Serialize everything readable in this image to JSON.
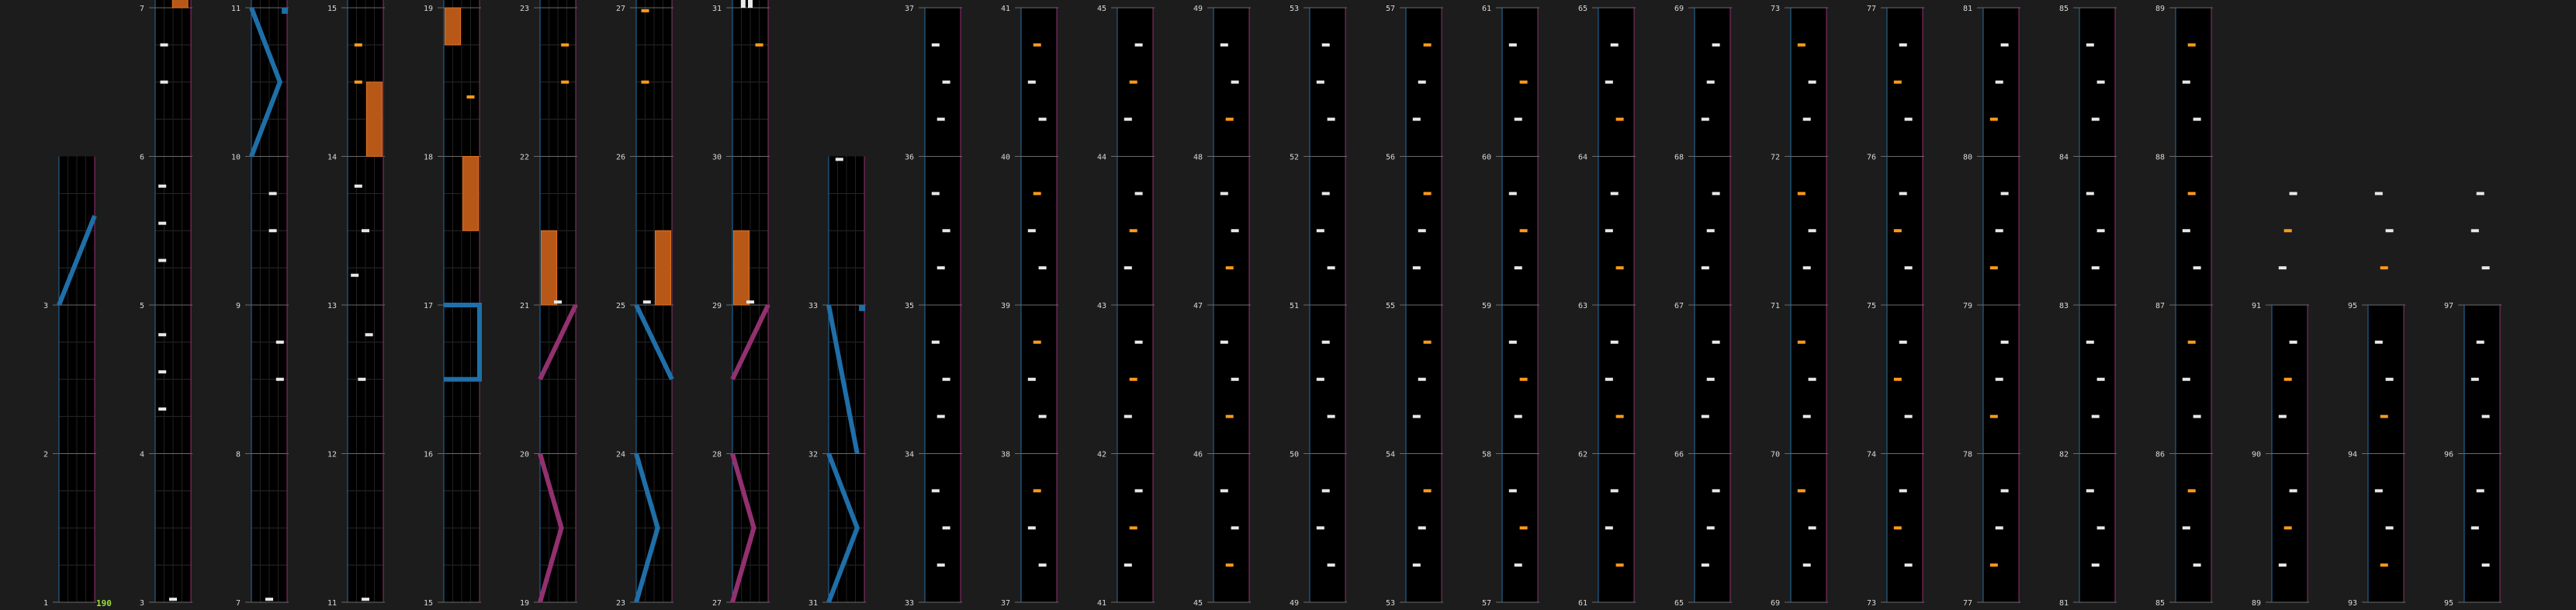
{
  "combo": "190",
  "colors": {
    "background": "#1c1c1c",
    "lane_bg": "#000000",
    "left_lane": "#1f6fa8",
    "right_lane": "#93306f",
    "hold": "#b85818",
    "tap_white": "#e8e8e8",
    "tap_orange": "#ff9a1a",
    "combo_text": "#9be03a"
  },
  "columns": [
    {
      "col": 0,
      "segments": [
        {
          "label": "1",
          "events": []
        },
        {
          "label": "2",
          "events": []
        },
        {
          "label": "3",
          "events": [
            {
              "type": "slide",
              "side": "L",
              "pts": [
                [
                  0,
                  0
                ],
                [
                  1,
                  0.6
                ]
              ]
            }
          ]
        }
      ]
    },
    {
      "col": 1,
      "segments": [
        {
          "label": "3",
          "events": [
            {
              "type": "tap",
              "lane": 0.5,
              "t": 0.02
            }
          ]
        },
        {
          "label": "4",
          "events": [
            {
              "type": "tap",
              "lane": 0.2,
              "t": 0.3
            },
            {
              "type": "tap",
              "lane": 0.2,
              "t": 0.55
            },
            {
              "type": "tap",
              "lane": 0.2,
              "t": 0.8
            }
          ]
        },
        {
          "label": "5",
          "events": [
            {
              "type": "tap",
              "lane": 0.2,
              "t": 0.3
            },
            {
              "type": "tap",
              "lane": 0.2,
              "t": 0.55
            },
            {
              "type": "tap",
              "lane": 0.2,
              "t": 0.8
            }
          ]
        },
        {
          "label": "6",
          "events": [
            {
              "type": "tap",
              "lane": 0.25,
              "t": 0.5
            },
            {
              "type": "tap",
              "lane": 0.25,
              "t": 0.75
            }
          ]
        },
        {
          "label": "7",
          "events": [
            {
              "type": "hold",
              "lane": 0.7,
              "t0": 0,
              "t1": 0.6
            },
            {
              "type": "tap",
              "lane": 0.4,
              "t": 0.98
            }
          ]
        }
      ]
    },
    {
      "col": 2,
      "segments": [
        {
          "label": "7",
          "events": [
            {
              "type": "tap",
              "lane": 0.5,
              "t": 0.02
            }
          ]
        },
        {
          "label": "8",
          "events": [
            {
              "type": "tap",
              "lane": 0.8,
              "t": 0.5
            },
            {
              "type": "tap",
              "lane": 0.8,
              "t": 0.75
            }
          ]
        },
        {
          "label": "9",
          "events": [
            {
              "type": "tap",
              "lane": 0.6,
              "t": 0.5
            },
            {
              "type": "tap",
              "lane": 0.6,
              "t": 0.75
            }
          ]
        },
        {
          "label": "10",
          "events": [
            {
              "type": "slide",
              "side": "L",
              "pts": [
                [
                  0,
                  0
                ],
                [
                  0.8,
                  0.5
                ],
                [
                  0,
                  1
                ]
              ]
            },
            {
              "type": "wall",
              "side": "L",
              "t": 0.98
            }
          ]
        },
        {
          "label": "11",
          "events": [
            {
              "type": "tap",
              "lane": 0.9,
              "t": 0.98
            }
          ]
        }
      ]
    },
    {
      "col": 3,
      "segments": [
        {
          "label": "11",
          "events": [
            {
              "type": "tap",
              "lane": 0.5,
              "t": 0.02
            }
          ]
        },
        {
          "label": "12",
          "events": [
            {
              "type": "tap",
              "lane": 0.4,
              "t": 0.5
            },
            {
              "type": "tap",
              "lane": 0.6,
              "t": 0.8
            }
          ]
        },
        {
          "label": "13",
          "events": [
            {
              "type": "tap",
              "lane": 0.2,
              "t": 0.2
            },
            {
              "type": "tap",
              "lane": 0.5,
              "t": 0.5
            },
            {
              "type": "tap",
              "lane": 0.3,
              "t": 0.8
            }
          ]
        },
        {
          "label": "14",
          "events": [
            {
              "type": "hold",
              "lane": 0.75,
              "t0": 0,
              "t1": 0.5
            },
            {
              "type": "tapo",
              "lane": 0.3,
              "t": 0.5
            },
            {
              "type": "tapo",
              "lane": 0.3,
              "t": 0.75
            }
          ]
        },
        {
          "label": "15",
          "events": [
            {
              "type": "tapo",
              "lane": 0.75,
              "t": 0.25
            },
            {
              "type": "tap",
              "lane": 0.5,
              "t": 0.55
            },
            {
              "type": "tap",
              "lane": 0.5,
              "t": 0.75
            },
            {
              "type": "tap",
              "lane": 0.75,
              "t": 0.98
            }
          ]
        }
      ]
    },
    {
      "col": 4,
      "segments": [
        {
          "label": "15",
          "events": []
        },
        {
          "label": "16",
          "events": [
            {
              "type": "wallpath",
              "side": "L",
              "pts": [
                [
                  0,
                  0.5
                ],
                [
                  1,
                  0.5
                ],
                [
                  1,
                  1
                ],
                [
                  0,
                  1
                ]
              ]
            }
          ]
        },
        {
          "label": "17",
          "events": [
            {
              "type": "hold",
              "lane": 0.75,
              "t0": 0.5,
              "t1": 1
            }
          ]
        },
        {
          "label": "18",
          "events": [
            {
              "type": "tapo",
              "lane": 0.75,
              "t": 0.4
            },
            {
              "type": "hold",
              "lane": 0.25,
              "t0": 0.75,
              "t1": 1
            }
          ]
        },
        {
          "label": "19",
          "events": [
            {
              "type": "wallpath",
              "side": "R",
              "pts": [
                [
                  0,
                  1
                ],
                [
                  0,
                  0.4
                ],
                [
                  1,
                  0.4
                ]
              ]
            }
          ]
        }
      ]
    },
    {
      "col": 5,
      "segments": [
        {
          "label": "19",
          "events": [
            {
              "type": "slide",
              "side": "R",
              "pts": [
                [
                  0,
                  0
                ],
                [
                  0.6,
                  0.5
                ],
                [
                  0,
                  1
                ]
              ]
            }
          ]
        },
        {
          "label": "20",
          "events": [
            {
              "type": "slide",
              "side": "R",
              "pts": [
                [
                  0,
                  0.5
                ],
                [
                  1,
                  1
                ]
              ]
            }
          ]
        },
        {
          "label": "21",
          "events": [
            {
              "type": "hold",
              "lane": 0.25,
              "t0": 0,
              "t1": 0.5
            },
            {
              "type": "tap",
              "lane": 0.5,
              "t": 0.02
            }
          ]
        },
        {
          "label": "22",
          "events": [
            {
              "type": "tapo",
              "lane": 0.7,
              "t": 0.5
            },
            {
              "type": "tapo",
              "lane": 0.7,
              "t": 0.75
            }
          ]
        },
        {
          "label": "23",
          "events": [
            {
              "type": "tap",
              "lane": 0.3,
              "t": 0.25
            },
            {
              "type": "tap",
              "lane": 0.5,
              "t": 0.5
            },
            {
              "type": "tap",
              "lane": 0.6,
              "t": 0.75
            },
            {
              "type": "wall",
              "side": "L",
              "t": 0.98
            }
          ]
        }
      ]
    },
    {
      "col": 6,
      "segments": [
        {
          "label": "23",
          "events": [
            {
              "type": "slide",
              "side": "L",
              "pts": [
                [
                  0,
                  0
                ],
                [
                  0.6,
                  0.5
                ],
                [
                  0,
                  1
                ]
              ]
            }
          ]
        },
        {
          "label": "24",
          "events": [
            {
              "type": "slide",
              "side": "L",
              "pts": [
                [
                  0,
                  1
                ],
                [
                  1,
                  0.5
                ]
              ]
            }
          ]
        },
        {
          "label": "25",
          "events": [
            {
              "type": "hold",
              "lane": 0.75,
              "t0": 0,
              "t1": 0.5
            },
            {
              "type": "tap",
              "lane": 0.3,
              "t": 0.02
            }
          ]
        },
        {
          "label": "26",
          "events": [
            {
              "type": "hold",
              "lane": 0.25,
              "t0": 0,
              "t1": 0
            },
            {
              "type": "tapo",
              "lane": 0.25,
              "t": 0.5
            },
            {
              "type": "tapo",
              "lane": 0.25,
              "t": 0.98
            }
          ]
        },
        {
          "label": "27",
          "events": [
            {
              "type": "wallpath",
              "side": "R",
              "pts": [
                [
                  0,
                  1
                ],
                [
                  0,
                  0.4
                ],
                [
                  1,
                  0.4
                ]
              ]
            }
          ]
        }
      ]
    },
    {
      "col": 7,
      "segments": [
        {
          "label": "27",
          "events": [
            {
              "type": "slide",
              "side": "R",
              "pts": [
                [
                  0,
                  0
                ],
                [
                  0.6,
                  0.5
                ],
                [
                  0,
                  1
                ]
              ]
            }
          ]
        },
        {
          "label": "28",
          "events": [
            {
              "type": "slide",
              "side": "R",
              "pts": [
                [
                  0,
                  0.5
                ],
                [
                  1,
                  1
                ]
              ]
            }
          ]
        },
        {
          "label": "29",
          "events": [
            {
              "type": "hold",
              "lane": 0.25,
              "t0": 0,
              "t1": 0.5
            },
            {
              "type": "tap",
              "lane": 0.5,
              "t": 0.02
            }
          ]
        },
        {
          "label": "30",
          "events": [
            {
              "type": "tapo",
              "lane": 0.75,
              "t": 0.75
            }
          ]
        },
        {
          "label": "31",
          "events": [
            {
              "type": "white_hold",
              "lane": 0.3,
              "t0": 0,
              "t1": 0.5
            },
            {
              "type": "white_hold",
              "lane": 0.5,
              "t0": 0,
              "t1": 0.5
            },
            {
              "type": "tap",
              "lane": 0.75,
              "t": 0.75
            }
          ]
        }
      ]
    },
    {
      "col": 8,
      "segments": [
        {
          "label": "31",
          "events": [
            {
              "type": "slide",
              "side": "L",
              "pts": [
                [
                  0,
                  0
                ],
                [
                  0.8,
                  0.5
                ],
                [
                  0,
                  1
                ]
              ]
            }
          ]
        },
        {
          "label": "32",
          "events": [
            {
              "type": "slide",
              "side": "L",
              "pts": [
                [
                  0.8,
                  0
                ],
                [
                  0,
                  1
                ]
              ]
            },
            {
              "type": "wall",
              "side": "L",
              "t": 0.98
            }
          ]
        },
        {
          "label": "33",
          "events": [
            {
              "type": "tap",
              "lane": 0.3,
              "t": 0.98
            }
          ]
        }
      ]
    }
  ]
}
